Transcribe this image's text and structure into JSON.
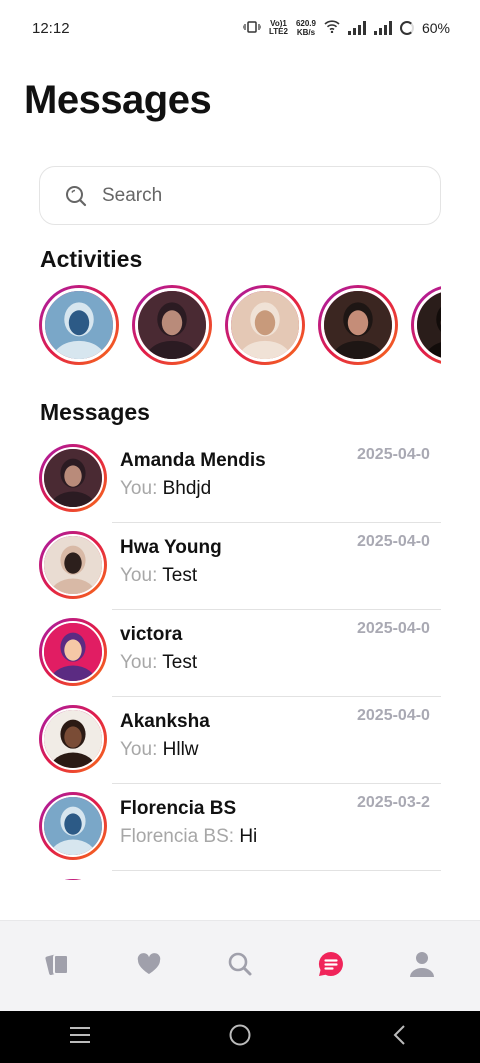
{
  "status_bar": {
    "time": "12:12",
    "volte_top": "Vo)1",
    "volte_bottom": "LTE2",
    "net_speed_value": "620.9",
    "net_speed_unit": "KB/s",
    "battery": "60%"
  },
  "header": {
    "title": "Messages"
  },
  "search": {
    "placeholder": "Search",
    "value": ""
  },
  "activities": {
    "title": "Activities",
    "stories": [
      {
        "photo_colors": [
          "#7aa7c8",
          "#2c5a86",
          "#d7e6ef"
        ]
      },
      {
        "photo_colors": [
          "#4a2a33",
          "#b98b7a",
          "#2b1b22"
        ]
      },
      {
        "photo_colors": [
          "#e4c8b5",
          "#c89a7b",
          "#f0e2d6"
        ]
      },
      {
        "photo_colors": [
          "#3b2621",
          "#c58d78",
          "#1e1614"
        ]
      },
      {
        "photo_colors": [
          "#2a1d1a",
          "#8a6a5a",
          "#120c0a"
        ]
      }
    ]
  },
  "messages": {
    "title": "Messages",
    "items": [
      {
        "name": "Amanda Mendis",
        "prefix": "You: ",
        "text": "Bhdjd",
        "date": "2025-04-0",
        "photo_colors": [
          "#4a2a33",
          "#b98b7a",
          "#2b1b22"
        ]
      },
      {
        "name": "Hwa Young",
        "prefix": "You: ",
        "text": "Test",
        "date": "2025-04-0",
        "photo_colors": [
          "#e9dcd2",
          "#2c1f1c",
          "#d8b9a6"
        ]
      },
      {
        "name": "victora",
        "prefix": "You: ",
        "text": "Test",
        "date": "2025-04-0",
        "photo_colors": [
          "#e11d63",
          "#f6c8a6",
          "#5b2b82"
        ]
      },
      {
        "name": "Akanksha",
        "prefix": "You: ",
        "text": "Hllw",
        "date": "2025-04-0",
        "photo_colors": [
          "#f1ece6",
          "#7a4c36",
          "#2b1a14"
        ]
      },
      {
        "name": "Florencia BS",
        "prefix": "Florencia BS: ",
        "text": "Hi",
        "date": "2025-03-2",
        "photo_colors": [
          "#7aa7c8",
          "#2c5a86",
          "#d7e6ef"
        ]
      },
      {
        "name": "",
        "prefix": "",
        "text": "",
        "date": "",
        "photo_colors": [
          "#c2185b",
          "#e11d48",
          "#f97316"
        ]
      }
    ]
  },
  "bottom_nav": {
    "items": [
      {
        "icon": "cards-icon",
        "active": false
      },
      {
        "icon": "heart-icon",
        "active": false
      },
      {
        "icon": "search-icon",
        "active": false
      },
      {
        "icon": "chat-icon",
        "active": true
      },
      {
        "icon": "profile-icon",
        "active": false
      }
    ],
    "inactive_color": "#a0a0ab",
    "active_color": "#f0245a"
  },
  "colors": {
    "accent": "#f0245a",
    "ring_start": "#a21caf",
    "ring_mid": "#e11d48",
    "ring_end": "#f97316",
    "muted_text": "#a7a7a7",
    "date_text": "#a9a9b3"
  }
}
